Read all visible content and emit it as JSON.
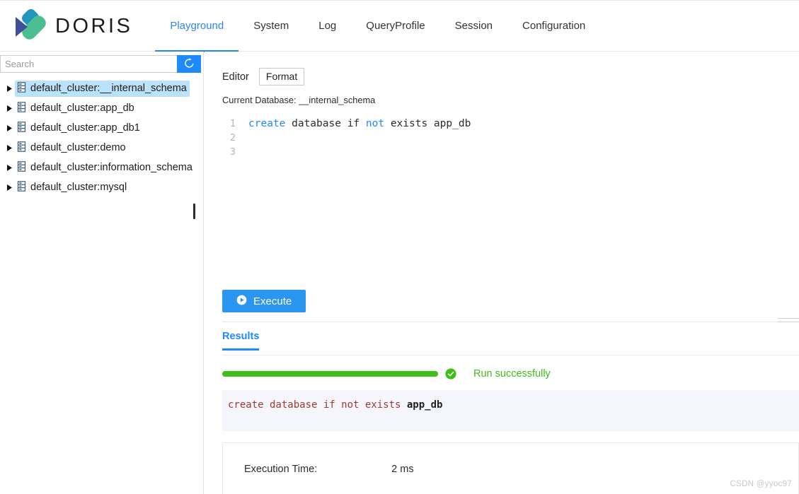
{
  "app": {
    "brand_name": "DORIS",
    "logo_colors": {
      "cyan": "#2196bf",
      "navy": "#414f96",
      "green": "#4cbf92"
    },
    "accent_color": "#1f8aff",
    "success_color": "#3ebe16"
  },
  "nav": {
    "items": [
      {
        "label": "Playground",
        "active": true
      },
      {
        "label": "System",
        "active": false
      },
      {
        "label": "Log",
        "active": false
      },
      {
        "label": "QueryProfile",
        "active": false
      },
      {
        "label": "Session",
        "active": false
      },
      {
        "label": "Configuration",
        "active": false
      }
    ]
  },
  "sidebar": {
    "search": {
      "value": "",
      "placeholder": "Search"
    },
    "refresh_icon": "refresh-icon",
    "tree": [
      {
        "label": "default_cluster:__internal_schema",
        "selected": true,
        "icon": "database-icon"
      },
      {
        "label": "default_cluster:app_db",
        "selected": false,
        "icon": "database-icon"
      },
      {
        "label": "default_cluster:app_db1",
        "selected": false,
        "icon": "database-icon"
      },
      {
        "label": "default_cluster:demo",
        "selected": false,
        "icon": "database-icon"
      },
      {
        "label": "default_cluster:information_schema",
        "selected": false,
        "icon": "database-icon"
      },
      {
        "label": "default_cluster:mysql",
        "selected": false,
        "icon": "database-icon"
      }
    ]
  },
  "editor": {
    "label": "Editor",
    "format_button": "Format",
    "current_database_label": "Current Database: __internal_schema",
    "lines": [
      {
        "number": "1",
        "tokens": [
          {
            "text": "create",
            "type": "keyword"
          },
          {
            "text": " database if ",
            "type": "plain"
          },
          {
            "text": "not",
            "type": "keyword"
          },
          {
            "text": " exists app_db",
            "type": "plain"
          }
        ]
      },
      {
        "number": "2",
        "tokens": []
      },
      {
        "number": "3",
        "tokens": []
      }
    ],
    "execute_button": "Execute",
    "execute_icon": "play-icon"
  },
  "results": {
    "tab_label": "Results",
    "status_text": "Run successfully",
    "status_icon": "check-circle-icon",
    "progress_percent": 100,
    "sql_prefix": "create database if not exists ",
    "sql_identifier": "app_db",
    "execution_time_label": "Execution Time:",
    "execution_time_value": "2 ms"
  },
  "watermark": "CSDN @yyoc97"
}
